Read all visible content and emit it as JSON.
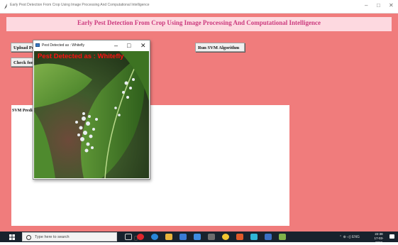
{
  "window": {
    "title": "Early Pest Detection From Crop Using Image Processing And Computational Intelligence",
    "minimize_glyph": "–",
    "maximize_glyph": "□",
    "close_glyph": "✕"
  },
  "app": {
    "heading": "Early Pest Detection From Crop Using Image Processing And Computational Intelligence",
    "upload_button": "Upload Pest Images",
    "check_button": "Check for Pest",
    "run_svm_button": "Run SVM Algorithm",
    "svm_label": "SVM Prediction Results"
  },
  "popup": {
    "title": "Pest Detected as : Whitefly",
    "overlay_text": "Pest Detected as : Whitefly",
    "minimize_glyph": "–",
    "maximize_glyph": "□",
    "close_glyph": "✕"
  },
  "taskbar": {
    "search_placeholder": "Type here to search",
    "tray_text": "⌃ ⊕ ◁) ENG",
    "time": "22:38",
    "date": "17-03-2022",
    "icons": [
      "task-view-icon",
      "opera-icon",
      "edge-icon",
      "file-explorer-icon",
      "store-icon",
      "mail-icon",
      "calculator-icon",
      "chrome-icon",
      "python-icon",
      "photos-icon",
      "settings-icon",
      "app-icon"
    ]
  },
  "colors": {
    "app_background": "#f07c7c",
    "heading_band": "#fdd9e0",
    "heading_text": "#cc3a7e",
    "overlay_text": "#ff1010",
    "taskbar": "#18222d"
  }
}
